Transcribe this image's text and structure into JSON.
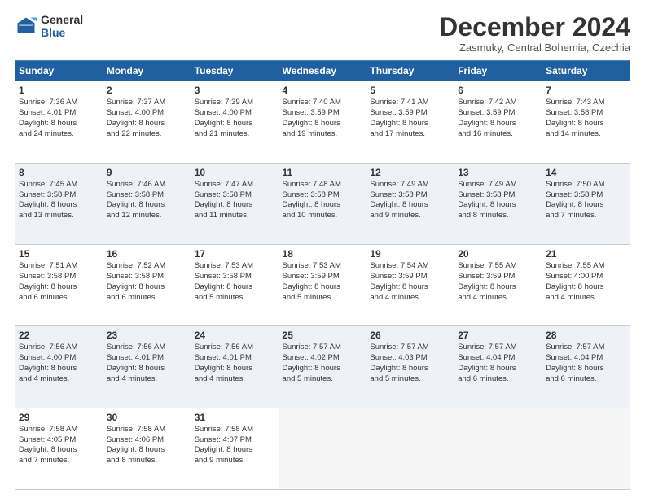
{
  "logo": {
    "line1": "General",
    "line2": "Blue"
  },
  "title": "December 2024",
  "location": "Zasmuky, Central Bohemia, Czechia",
  "headers": [
    "Sunday",
    "Monday",
    "Tuesday",
    "Wednesday",
    "Thursday",
    "Friday",
    "Saturday"
  ],
  "weeks": [
    [
      {
        "day": "1",
        "lines": [
          "Sunrise: 7:36 AM",
          "Sunset: 4:01 PM",
          "Daylight: 8 hours",
          "and 24 minutes."
        ]
      },
      {
        "day": "2",
        "lines": [
          "Sunrise: 7:37 AM",
          "Sunset: 4:00 PM",
          "Daylight: 8 hours",
          "and 22 minutes."
        ]
      },
      {
        "day": "3",
        "lines": [
          "Sunrise: 7:39 AM",
          "Sunset: 4:00 PM",
          "Daylight: 8 hours",
          "and 21 minutes."
        ]
      },
      {
        "day": "4",
        "lines": [
          "Sunrise: 7:40 AM",
          "Sunset: 3:59 PM",
          "Daylight: 8 hours",
          "and 19 minutes."
        ]
      },
      {
        "day": "5",
        "lines": [
          "Sunrise: 7:41 AM",
          "Sunset: 3:59 PM",
          "Daylight: 8 hours",
          "and 17 minutes."
        ]
      },
      {
        "day": "6",
        "lines": [
          "Sunrise: 7:42 AM",
          "Sunset: 3:59 PM",
          "Daylight: 8 hours",
          "and 16 minutes."
        ]
      },
      {
        "day": "7",
        "lines": [
          "Sunrise: 7:43 AM",
          "Sunset: 3:58 PM",
          "Daylight: 8 hours",
          "and 14 minutes."
        ]
      }
    ],
    [
      {
        "day": "8",
        "lines": [
          "Sunrise: 7:45 AM",
          "Sunset: 3:58 PM",
          "Daylight: 8 hours",
          "and 13 minutes."
        ]
      },
      {
        "day": "9",
        "lines": [
          "Sunrise: 7:46 AM",
          "Sunset: 3:58 PM",
          "Daylight: 8 hours",
          "and 12 minutes."
        ]
      },
      {
        "day": "10",
        "lines": [
          "Sunrise: 7:47 AM",
          "Sunset: 3:58 PM",
          "Daylight: 8 hours",
          "and 11 minutes."
        ]
      },
      {
        "day": "11",
        "lines": [
          "Sunrise: 7:48 AM",
          "Sunset: 3:58 PM",
          "Daylight: 8 hours",
          "and 10 minutes."
        ]
      },
      {
        "day": "12",
        "lines": [
          "Sunrise: 7:49 AM",
          "Sunset: 3:58 PM",
          "Daylight: 8 hours",
          "and 9 minutes."
        ]
      },
      {
        "day": "13",
        "lines": [
          "Sunrise: 7:49 AM",
          "Sunset: 3:58 PM",
          "Daylight: 8 hours",
          "and 8 minutes."
        ]
      },
      {
        "day": "14",
        "lines": [
          "Sunrise: 7:50 AM",
          "Sunset: 3:58 PM",
          "Daylight: 8 hours",
          "and 7 minutes."
        ]
      }
    ],
    [
      {
        "day": "15",
        "lines": [
          "Sunrise: 7:51 AM",
          "Sunset: 3:58 PM",
          "Daylight: 8 hours",
          "and 6 minutes."
        ]
      },
      {
        "day": "16",
        "lines": [
          "Sunrise: 7:52 AM",
          "Sunset: 3:58 PM",
          "Daylight: 8 hours",
          "and 6 minutes."
        ]
      },
      {
        "day": "17",
        "lines": [
          "Sunrise: 7:53 AM",
          "Sunset: 3:58 PM",
          "Daylight: 8 hours",
          "and 5 minutes."
        ]
      },
      {
        "day": "18",
        "lines": [
          "Sunrise: 7:53 AM",
          "Sunset: 3:59 PM",
          "Daylight: 8 hours",
          "and 5 minutes."
        ]
      },
      {
        "day": "19",
        "lines": [
          "Sunrise: 7:54 AM",
          "Sunset: 3:59 PM",
          "Daylight: 8 hours",
          "and 4 minutes."
        ]
      },
      {
        "day": "20",
        "lines": [
          "Sunrise: 7:55 AM",
          "Sunset: 3:59 PM",
          "Daylight: 8 hours",
          "and 4 minutes."
        ]
      },
      {
        "day": "21",
        "lines": [
          "Sunrise: 7:55 AM",
          "Sunset: 4:00 PM",
          "Daylight: 8 hours",
          "and 4 minutes."
        ]
      }
    ],
    [
      {
        "day": "22",
        "lines": [
          "Sunrise: 7:56 AM",
          "Sunset: 4:00 PM",
          "Daylight: 8 hours",
          "and 4 minutes."
        ]
      },
      {
        "day": "23",
        "lines": [
          "Sunrise: 7:56 AM",
          "Sunset: 4:01 PM",
          "Daylight: 8 hours",
          "and 4 minutes."
        ]
      },
      {
        "day": "24",
        "lines": [
          "Sunrise: 7:56 AM",
          "Sunset: 4:01 PM",
          "Daylight: 8 hours",
          "and 4 minutes."
        ]
      },
      {
        "day": "25",
        "lines": [
          "Sunrise: 7:57 AM",
          "Sunset: 4:02 PM",
          "Daylight: 8 hours",
          "and 5 minutes."
        ]
      },
      {
        "day": "26",
        "lines": [
          "Sunrise: 7:57 AM",
          "Sunset: 4:03 PM",
          "Daylight: 8 hours",
          "and 5 minutes."
        ]
      },
      {
        "day": "27",
        "lines": [
          "Sunrise: 7:57 AM",
          "Sunset: 4:04 PM",
          "Daylight: 8 hours",
          "and 6 minutes."
        ]
      },
      {
        "day": "28",
        "lines": [
          "Sunrise: 7:57 AM",
          "Sunset: 4:04 PM",
          "Daylight: 8 hours",
          "and 6 minutes."
        ]
      }
    ],
    [
      {
        "day": "29",
        "lines": [
          "Sunrise: 7:58 AM",
          "Sunset: 4:05 PM",
          "Daylight: 8 hours",
          "and 7 minutes."
        ]
      },
      {
        "day": "30",
        "lines": [
          "Sunrise: 7:58 AM",
          "Sunset: 4:06 PM",
          "Daylight: 8 hours",
          "and 8 minutes."
        ]
      },
      {
        "day": "31",
        "lines": [
          "Sunrise: 7:58 AM",
          "Sunset: 4:07 PM",
          "Daylight: 8 hours",
          "and 9 minutes."
        ]
      },
      null,
      null,
      null,
      null
    ]
  ]
}
